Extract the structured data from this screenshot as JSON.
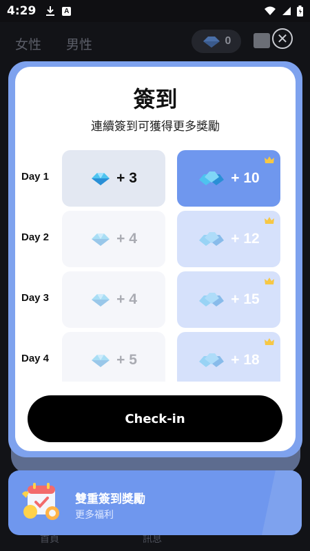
{
  "status_bar": {
    "time": "4:29"
  },
  "app": {
    "tabs": [
      "女性",
      "男性"
    ],
    "coin_count": "0",
    "bottom_labels": [
      "首頁",
      "訊息"
    ]
  },
  "modal": {
    "title": "簽到",
    "subtitle": "連續簽到可獲得更多獎勵",
    "rows": [
      {
        "day": "Day 1",
        "normal": "+ 3",
        "vip": "+ 10"
      },
      {
        "day": "Day 2",
        "normal": "+ 4",
        "vip": "+ 12"
      },
      {
        "day": "Day 3",
        "normal": "+ 4",
        "vip": "+ 15"
      },
      {
        "day": "Day 4",
        "normal": "+ 5",
        "vip": "+ 18"
      }
    ],
    "checkin_label": "Check-in",
    "close_icon": "close-icon"
  },
  "banner": {
    "title": "雙重簽到獎勵",
    "subtitle": "更多福利",
    "icon": "calendar-bell-icon"
  },
  "colors": {
    "accent": "#6f97ee",
    "vip_cell": "#d6e1fb",
    "active_normal": "#e3e8f2",
    "button": "#000000"
  }
}
